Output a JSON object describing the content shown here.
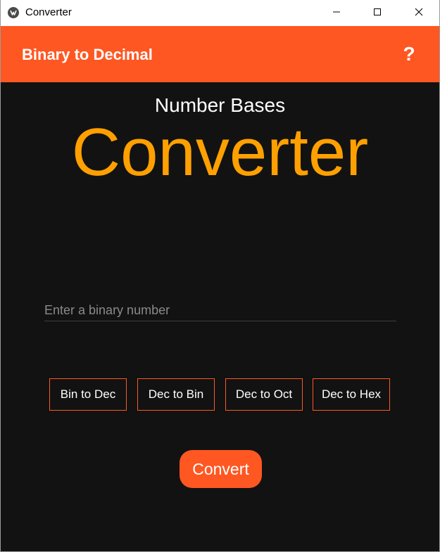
{
  "window": {
    "title": "Converter",
    "minimize_icon": "minimize-icon",
    "maximize_icon": "maximize-icon",
    "close_icon": "close-icon"
  },
  "appbar": {
    "title": "Binary to Decimal",
    "help_label": "?",
    "color": "#ff5722"
  },
  "main": {
    "subtitle": "Number Bases",
    "title": "Converter",
    "title_color": "#ffa000",
    "background": "#121212"
  },
  "input": {
    "placeholder": "Enter a binary number",
    "value": ""
  },
  "modes": [
    {
      "label": "Bin to Dec"
    },
    {
      "label": "Dec to Bin"
    },
    {
      "label": "Dec to Oct"
    },
    {
      "label": "Dec to Hex"
    }
  ],
  "convert": {
    "label": "Convert"
  }
}
